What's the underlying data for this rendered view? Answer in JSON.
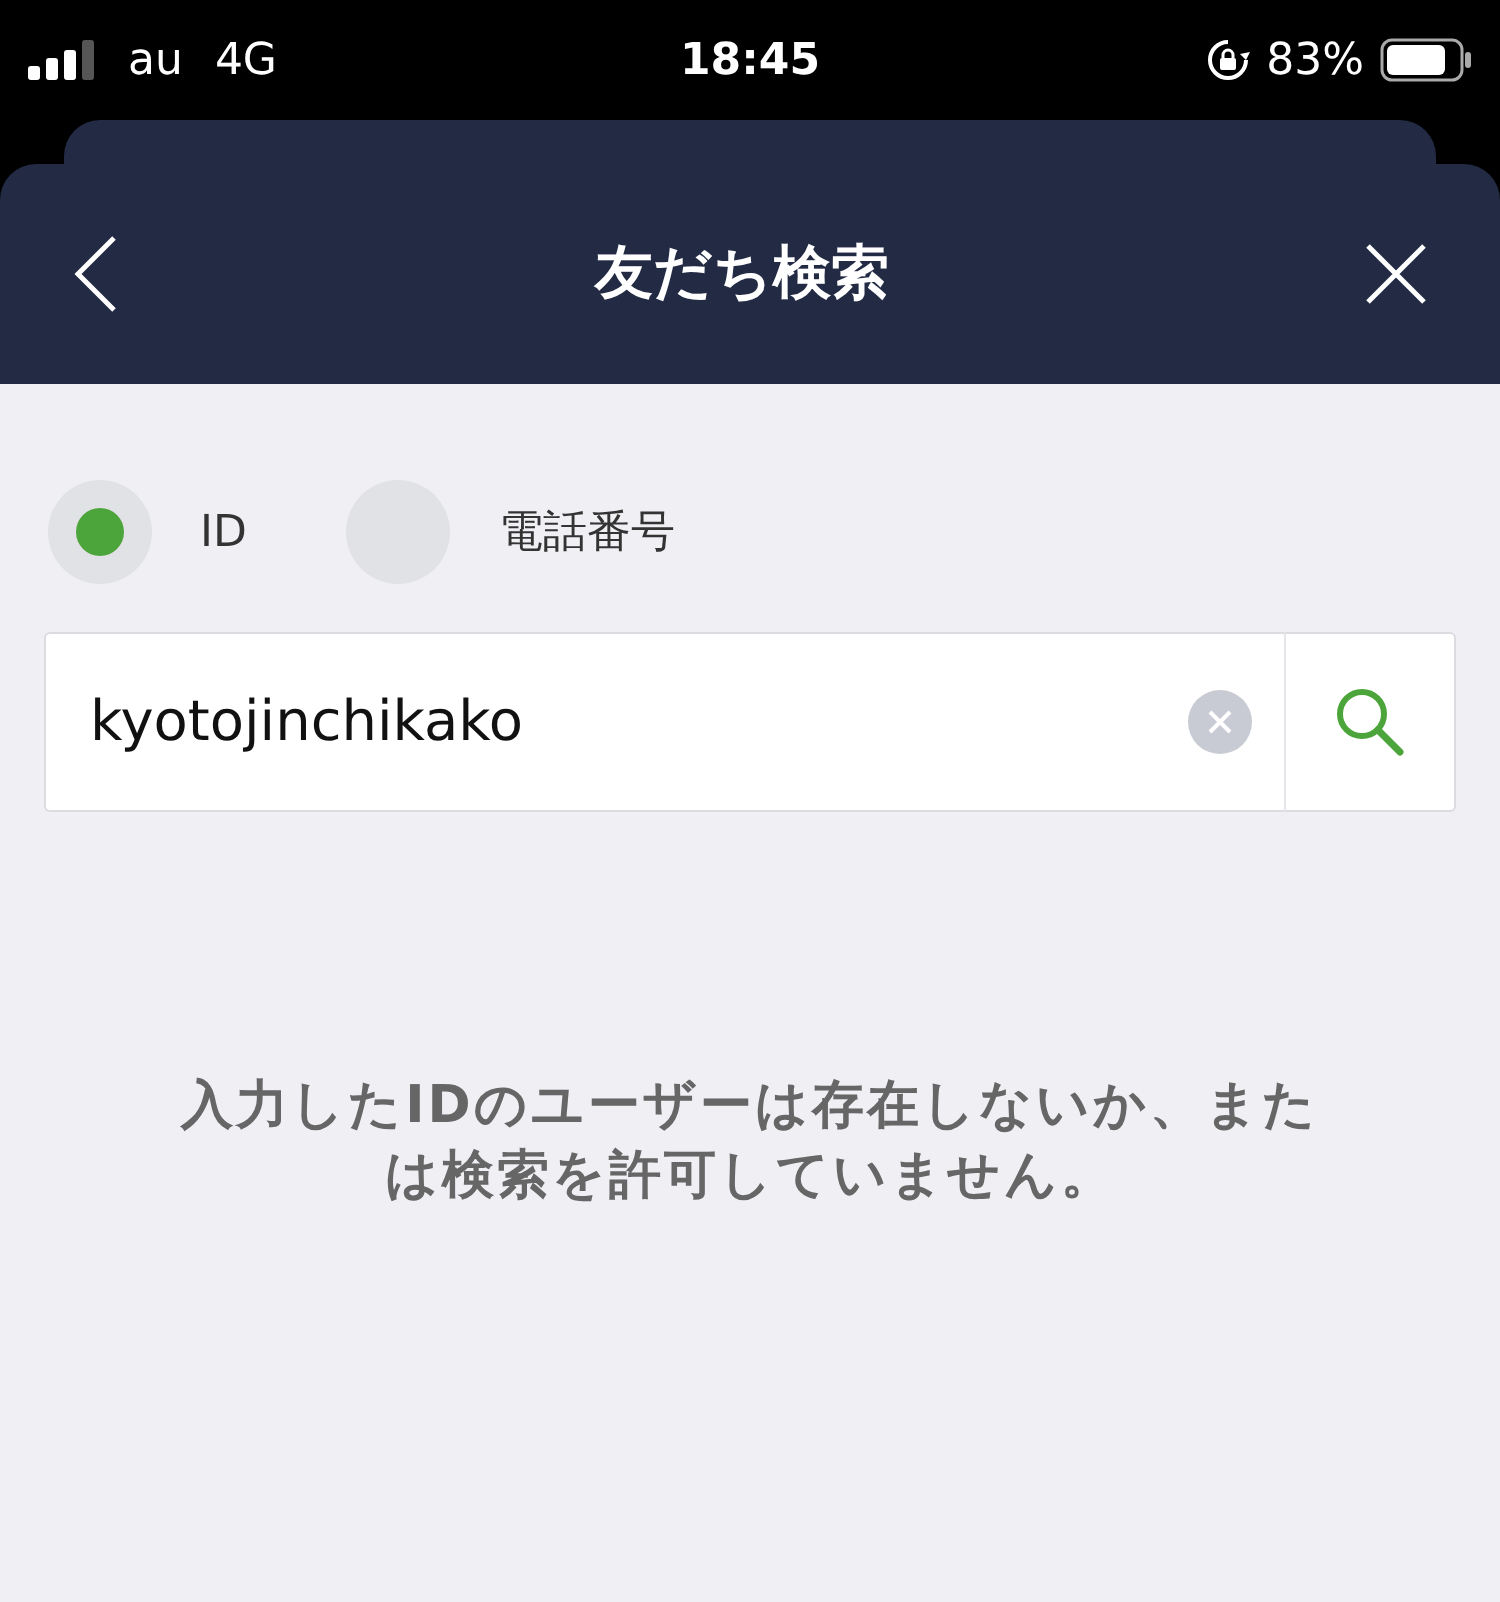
{
  "status_bar": {
    "carrier": "au",
    "network": "4G",
    "time": "18:45",
    "battery": "83%"
  },
  "header": {
    "title": "友だち検索"
  },
  "search_type": [
    {
      "label": "ID",
      "selected": true
    },
    {
      "label": "電話番号",
      "selected": false
    }
  ],
  "search": {
    "value": "kyotojinchikako"
  },
  "message": "入力したIDのユーザーは存在しないか、または検索を許可していません。"
}
